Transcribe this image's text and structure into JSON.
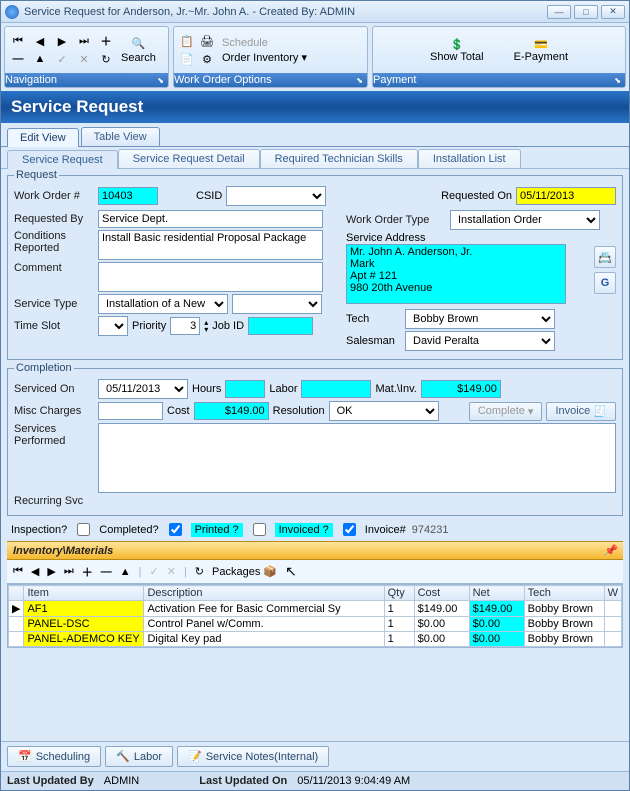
{
  "window": {
    "title": "Service Request for Anderson, Jr.~Mr. John A. - Created By: ADMIN"
  },
  "ribbon": {
    "nav": {
      "caption": "Navigation",
      "search": "Search"
    },
    "opts": {
      "caption": "Work Order Options",
      "schedule": "Schedule",
      "order_inv": "Order Inventory"
    },
    "pay": {
      "caption": "Payment",
      "show_total": "Show Total",
      "epay": "E-Payment"
    }
  },
  "page_title": "Service Request",
  "main_tabs": {
    "edit": "Edit View",
    "table": "Table View"
  },
  "subtabs": {
    "sr": "Service Request",
    "srd": "Service Request Detail",
    "rts": "Required Technician Skills",
    "il": "Installation List"
  },
  "request": {
    "legend": "Request",
    "wo_lbl": "Work Order #",
    "wo": "10403",
    "csid_lbl": "CSID",
    "csid": "",
    "req_on_lbl": "Requested On",
    "req_on": "05/11/2013",
    "req_by_lbl": "Requested By",
    "req_by": "Service Dept.",
    "wo_type_lbl": "Work Order Type",
    "wo_type": "Installation Order",
    "cond_lbl": "Conditions Reported",
    "cond": "Install Basic residential Proposal Package",
    "svc_addr_lbl": "Service Address",
    "svc_addr": "Mr. John A. Anderson, Jr.\nMark\nApt # 121\n980 20th Avenue",
    "comment_lbl": "Comment",
    "comment": "",
    "svc_type_lbl": "Service Type",
    "svc_type": "Installation of a New Sect",
    "tech_lbl": "Tech",
    "tech": "Bobby Brown",
    "slot_lbl": "Time Slot",
    "slot": "",
    "priority_lbl": "Priority",
    "priority": "3",
    "jobid_lbl": "Job ID",
    "jobid": "",
    "salesman_lbl": "Salesman",
    "salesman": "David Peralta"
  },
  "completion": {
    "legend": "Completion",
    "serviced_on_lbl": "Serviced On",
    "serviced_on": "05/11/2013",
    "hours_lbl": "Hours",
    "hours": "",
    "labor_lbl": "Labor",
    "labor": "",
    "matinv_lbl": "Mat.\\Inv.",
    "matinv": "$149.00",
    "misc_lbl": "Misc Charges",
    "misc": "",
    "cost_lbl": "Cost",
    "cost": "$149.00",
    "resolution_lbl": "Resolution",
    "resolution": "OK",
    "complete_btn": "Complete",
    "invoice_btn": "Invoice",
    "svc_perf_lbl": "Services Performed",
    "svc_perf": "",
    "recurring_lbl": "Recurring Svc"
  },
  "flags": {
    "inspection_lbl": "Inspection?",
    "inspection": false,
    "completed_lbl": "Completed?",
    "completed": true,
    "printed_lbl": "Printed ?",
    "printed": false,
    "invoiced_lbl": "Invoiced ?",
    "invoiced": true,
    "invoice_num_lbl": "Invoice#",
    "invoice_num": "974231"
  },
  "inventory": {
    "title": "Inventory\\Materials",
    "packages": "Packages",
    "cols": {
      "item": "Item",
      "desc": "Description",
      "qty": "Qty",
      "cost": "Cost",
      "net": "Net",
      "tech": "Tech",
      "w": "W"
    },
    "rows": [
      {
        "item": "AF1",
        "desc": "Activation Fee for Basic Commercial Sy",
        "qty": "1",
        "cost": "$149.00",
        "net": "$149.00",
        "tech": "Bobby Brown"
      },
      {
        "item": "PANEL-DSC",
        "desc": "Control Panel w/Comm.",
        "qty": "1",
        "cost": "$0.00",
        "net": "$0.00",
        "tech": "Bobby Brown"
      },
      {
        "item": "PANEL-ADEMCO KEY",
        "desc": "Digital Key pad",
        "qty": "1",
        "cost": "$0.00",
        "net": "$0.00",
        "tech": "Bobby Brown"
      }
    ]
  },
  "bottom_tabs": {
    "sched": "Scheduling",
    "labor": "Labor",
    "notes": "Service Notes(Internal)"
  },
  "status": {
    "upd_by_lbl": "Last Updated By",
    "upd_by": "ADMIN",
    "upd_on_lbl": "Last Updated On",
    "upd_on": "05/11/2013 9:04:49 AM"
  }
}
